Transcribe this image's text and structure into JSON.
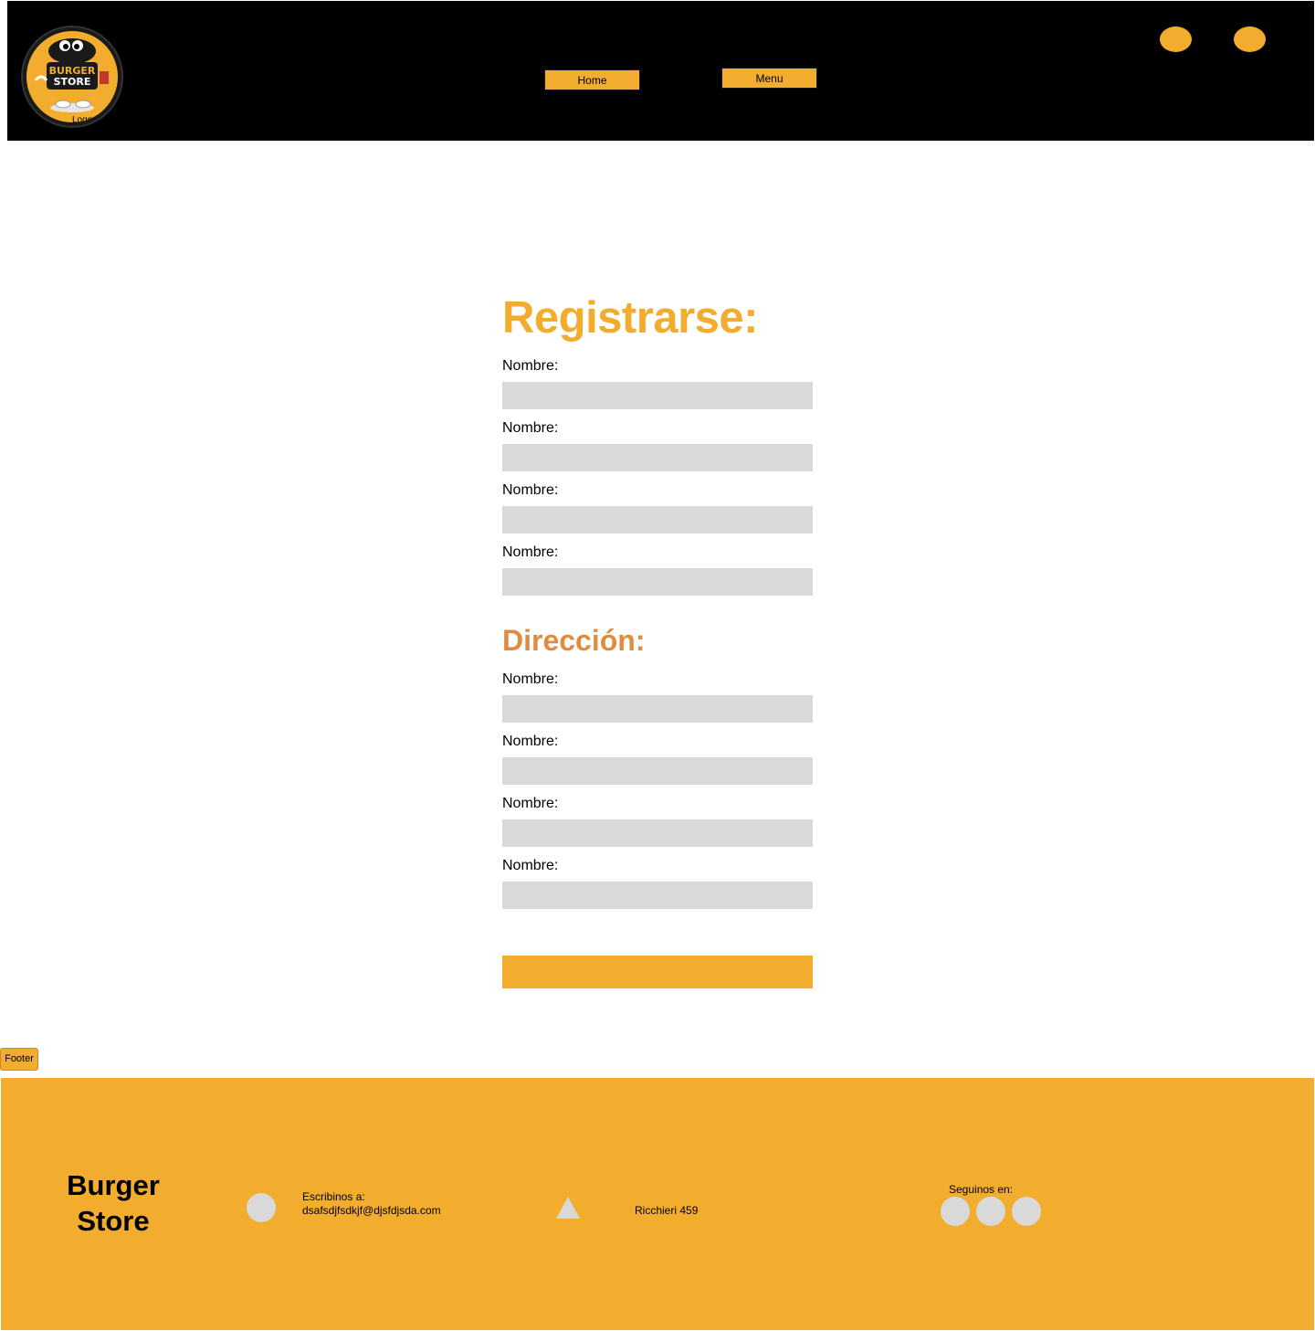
{
  "header": {
    "logo_text_line1": "BURGER",
    "logo_text_line2": "STORE",
    "logo_caption": "Logo",
    "nav": {
      "home_label": "Home",
      "menu_label": "Menu"
    }
  },
  "form": {
    "title": "Registrarse:",
    "personal_fields": [
      {
        "label": "Nombre:",
        "value": ""
      },
      {
        "label": "Nombre:",
        "value": ""
      },
      {
        "label": "Nombre:",
        "value": ""
      },
      {
        "label": "Nombre:",
        "value": ""
      }
    ],
    "address_title": "Dirección:",
    "address_fields": [
      {
        "label": "Nombre:",
        "value": ""
      },
      {
        "label": "Nombre:",
        "value": ""
      },
      {
        "label": "Nombre:",
        "value": ""
      },
      {
        "label": "Nombre:",
        "value": ""
      }
    ],
    "submit_label": ""
  },
  "footer": {
    "tag": "Footer",
    "brand_line1": "Burger",
    "brand_line2": "Store",
    "contact_prefix": "Escribinos a:",
    "contact_email": "dsafsdjfsdkjf@djsfdjsda.com",
    "address": "Ricchieri 459",
    "follow_label": "Seguinos en:"
  },
  "colors": {
    "accent": "#f2ac2e",
    "section_title": "#e08c3e",
    "header_bg": "#000000",
    "input_bg": "#d9d9d9"
  }
}
